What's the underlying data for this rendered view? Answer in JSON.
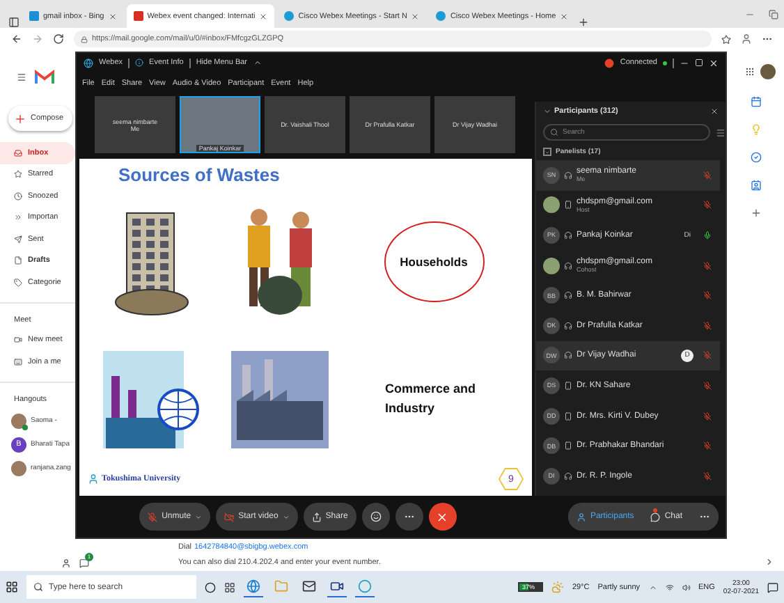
{
  "browser": {
    "tabs": [
      {
        "title": "gmail inbox - Bing",
        "selected": false
      },
      {
        "title": "Webex event changed: Internati",
        "selected": true
      },
      {
        "title": "Cisco Webex Meetings - Start N",
        "selected": false
      },
      {
        "title": "Cisco Webex Meetings - Home",
        "selected": false
      }
    ],
    "address": "https://mail.google.com/mail/u/0/#inbox/FMfcgzGLZGPQ"
  },
  "gmail": {
    "compose": "Compose",
    "nav": [
      {
        "label": "Inbox",
        "selected": true,
        "bold": false
      },
      {
        "label": "Starred",
        "selected": false,
        "bold": false
      },
      {
        "label": "Snoozed",
        "selected": false,
        "bold": false
      },
      {
        "label": "Importan",
        "selected": false,
        "bold": false
      },
      {
        "label": "Sent",
        "selected": false,
        "bold": false
      },
      {
        "label": "Drafts",
        "selected": false,
        "bold": true
      },
      {
        "label": "Categorie",
        "selected": false,
        "bold": false
      }
    ],
    "meet": {
      "title": "Meet",
      "items": [
        {
          "label": "New meet"
        },
        {
          "label": "Join a me"
        }
      ]
    },
    "hangouts": {
      "title": "Hangouts",
      "contacts": [
        {
          "name": "Saoma -",
          "online": true
        },
        {
          "name": "Bharati Tapa",
          "letter": "B",
          "online": false
        },
        {
          "name": "ranjana.zang",
          "online": false
        }
      ]
    },
    "chat_badge": "1",
    "dial": {
      "prefix": "Dial",
      "link": "1642784840@sbigbg.webex.com"
    },
    "note": "You can also dial 210.4.202.4 and enter your event number."
  },
  "webex": {
    "app": "Webex",
    "event_info": "Event Info",
    "hide_menu": "Hide Menu Bar",
    "status": "Connected",
    "menu": [
      "File",
      "Edit",
      "Share",
      "View",
      "Audio & Video",
      "Participant",
      "Event",
      "Help"
    ],
    "video_tiles": [
      {
        "name": "seema nimbarte",
        "subtitle": "Me",
        "video": false,
        "selected": false
      },
      {
        "name": "Pankaj Koinkar",
        "video": true,
        "selected": true
      },
      {
        "name": "Dr. Vaishali Thool",
        "video": false,
        "selected": false
      },
      {
        "name": "Dr Prafulla Katkar",
        "video": false,
        "selected": false
      },
      {
        "name": "Dr Vijay Wadhai",
        "video": false,
        "selected": false
      }
    ],
    "slide": {
      "title": "Sources of Wastes",
      "labels": [
        {
          "text": "Households",
          "circled": true
        },
        {
          "text": "Commerce and Industry",
          "circled": false
        }
      ],
      "logo": "Tokushima University",
      "page": "9"
    },
    "participants": {
      "title": "Participants (312)",
      "search_placeholder": "Search",
      "group": "Panelists (17)",
      "group_expanded": true,
      "items": [
        {
          "initials": "SN",
          "name": "seema nimbarte",
          "role": "Me",
          "kind": "computer",
          "muted": true,
          "selected": true
        },
        {
          "name": "chdspm@gmail.com",
          "role": "Host",
          "kind": "phone",
          "muted": true,
          "selected": false
        },
        {
          "initials": "PK",
          "name": "Pankaj Koinkar",
          "kind": "computer",
          "muted": false,
          "selected": false,
          "tag": {
            "kind": "plain",
            "text": "Di"
          }
        },
        {
          "name": "chdspm@gmail.com",
          "role": "Cohost",
          "kind": "computer",
          "muted": true,
          "selected": false
        },
        {
          "initials": "BB",
          "name": "B. M. Bahirwar",
          "kind": "computer",
          "muted": true,
          "selected": false
        },
        {
          "initials": "DK",
          "name": "Dr Prafulla Katkar",
          "kind": "computer",
          "muted": true,
          "selected": false
        },
        {
          "initials": "DW",
          "name": "Dr Vijay Wadhai",
          "kind": "computer",
          "muted": true,
          "selected": true,
          "tag": {
            "kind": "circle",
            "text": "D"
          }
        },
        {
          "initials": "DS",
          "name": "Dr. KN Sahare",
          "kind": "phone",
          "muted": true,
          "selected": false
        },
        {
          "initials": "DD",
          "name": "Dr. Mrs. Kirti V. Dubey",
          "kind": "phone",
          "muted": true,
          "selected": false
        },
        {
          "initials": "DB",
          "name": "Dr. Prabhakar Bhandari",
          "kind": "phone",
          "muted": true,
          "selected": false
        },
        {
          "initials": "DI",
          "name": "Dr. R. P. Ingole",
          "kind": "computer",
          "muted": true,
          "selected": false
        }
      ]
    },
    "controls": {
      "unmute": "Unmute",
      "start_video": "Start video",
      "share": "Share",
      "participants": "Participants",
      "participants_active": true,
      "chat": "Chat",
      "chat_unread": true
    }
  },
  "taskbar": {
    "search_placeholder": "Type here to search",
    "battery": "37%",
    "temperature": "29°C",
    "condition": "Partly sunny",
    "language": "ENG",
    "time": "23:00",
    "date": "02-07-2021"
  }
}
